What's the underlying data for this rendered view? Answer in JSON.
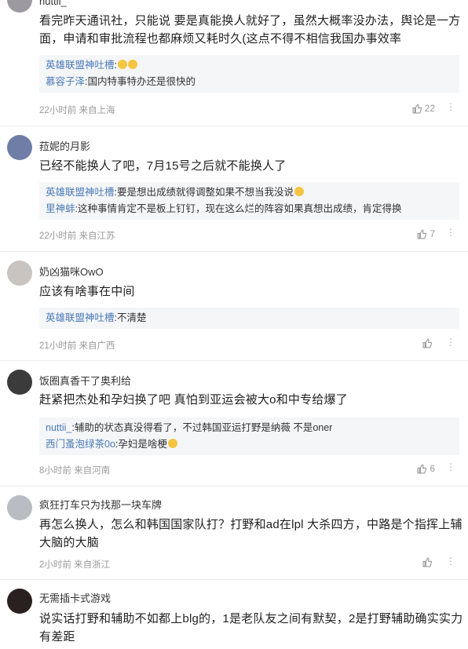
{
  "comments": [
    {
      "username": "nuttii_",
      "text": "看完昨天通讯社，只能说 要是真能换人就好了，虽然大概率没办法，舆论是一方面，申请和审批流程也都麻烦又耗时久(这点不得不相信我国办事效率",
      "replies": [
        {
          "user": "英雄联盟神吐槽",
          "text": ""
        },
        {
          "user": "慕容子泽",
          "text": "国内特事特办还是很快的"
        }
      ],
      "meta": "22小时前 来自上海",
      "likes": "22"
    },
    {
      "username": "菈妮的月影",
      "text": "已经不能换人了吧，7月15号之后就不能换人了",
      "replies": [
        {
          "user": "英雄联盟神吐槽",
          "text": "要是想出成绩就得调整如果不想当我没说"
        },
        {
          "user": "里神蚌",
          "text": "这种事情肯定不是板上钉钉，现在这么烂的阵容如果真想出成绩，肯定得换"
        }
      ],
      "meta": "22小时前 来自江苏",
      "likes": "7"
    },
    {
      "username": "奶凶猫咪OwO",
      "text": "应该有啥事在中间",
      "replies": [
        {
          "user": "英雄联盟神吐槽",
          "text": "不清楚"
        }
      ],
      "meta": "21小时前 来自广西",
      "likes": ""
    },
    {
      "username": "饭圈真香干了奥利给",
      "text": "赶紧把杰处和孕妇换了吧 真怕到亚运会被大o和中专给爆了",
      "replies": [
        {
          "user": "nuttii_",
          "text": "辅助的状态真没得看了，不过韩国亚运打野是纳薇 不是oner"
        },
        {
          "user": "西门蚤泡绿茶0o",
          "text": "孕妇是啥梗"
        }
      ],
      "meta": "8小时前 来自河南",
      "likes": "6"
    },
    {
      "username": "疯狂打车只为找那一块车牌",
      "text": "再怎么换人，怎么和韩国国家队打？打野和ad在lpl 大杀四方，中路是个指挥上辅大脑的大脑",
      "replies": [],
      "meta": "2小时前 来自浙江",
      "likes": ""
    },
    {
      "username": "无需插卡式游戏",
      "text": "说实话打野和辅助不如都上blg的，1是老队友之间有默契，2是打野辅助确实实力有差距",
      "replies": [],
      "meta": "",
      "likes": ""
    }
  ],
  "icons": {
    "like": "thumbs-up-icon",
    "more": "more-options-icon"
  }
}
